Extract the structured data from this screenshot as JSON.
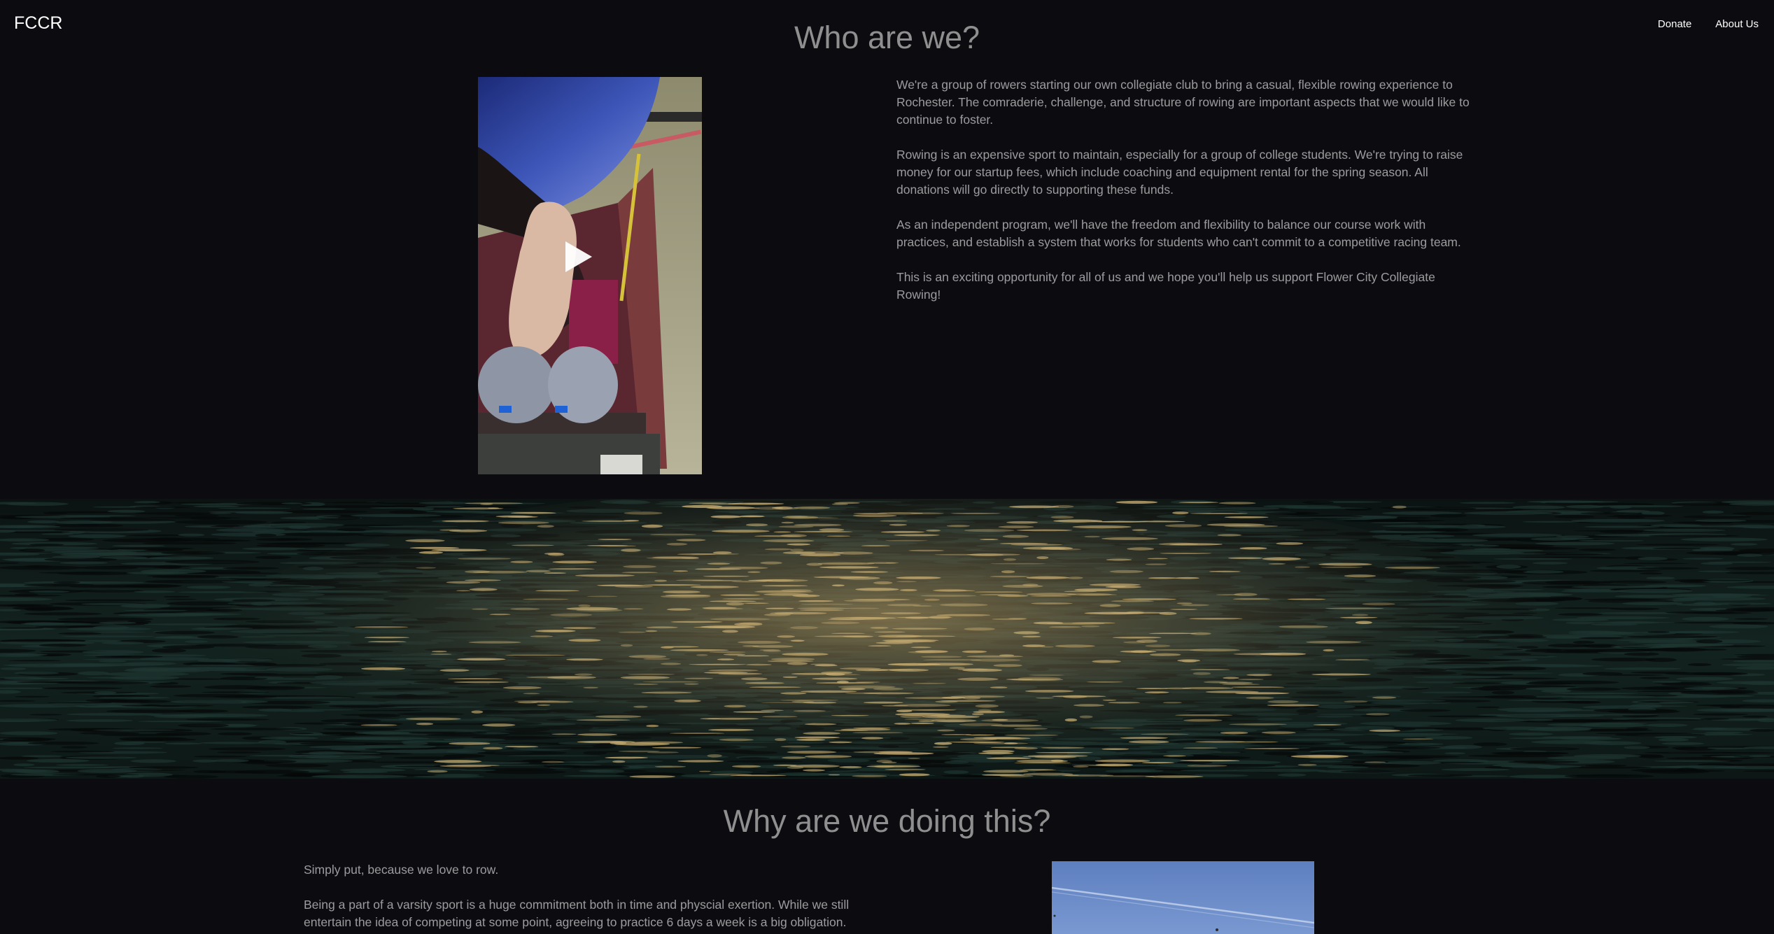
{
  "nav": {
    "brand": "FCCR",
    "links": [
      {
        "label": "Donate"
      },
      {
        "label": "About Us"
      }
    ]
  },
  "who": {
    "heading": "Who are we?",
    "paragraphs": [
      "We're a group of rowers starting our own collegiate club to bring a casual, flexible rowing experience to Rochester. The comraderie, challenge, and structure of rowing are important aspects that we would like to continue to foster.",
      "Rowing is an expensive sport to maintain, especially for a group of college students. We're trying to raise money for our startup fees, which include coaching and equipment rental for the spring season. All donations will go directly to supporting these funds.",
      "As an independent program, we'll have the freedom and flexibility to balance our course work with practices, and establish a system that works for students who can't commit to a competitive racing team.",
      "This is an exciting opportunity for all of us and we hope you'll help us support Flower City Collegiate Rowing!"
    ]
  },
  "why": {
    "heading": "Why are we doing this?",
    "paragraphs": [
      "Simply put, because we love to row.",
      "Being a part of a varsity sport is a huge commitment both in time and physcial exertion. While we still entertain the idea of competing at some point, agreeing to practice 6 days a week is a big obligation."
    ]
  },
  "colors": {
    "background": "#0c0b10",
    "heading": "#8f8f90",
    "body_text": "#9c9c9e",
    "nav_text": "#ffffff"
  },
  "icons": {
    "video_play": "play-triangle"
  }
}
